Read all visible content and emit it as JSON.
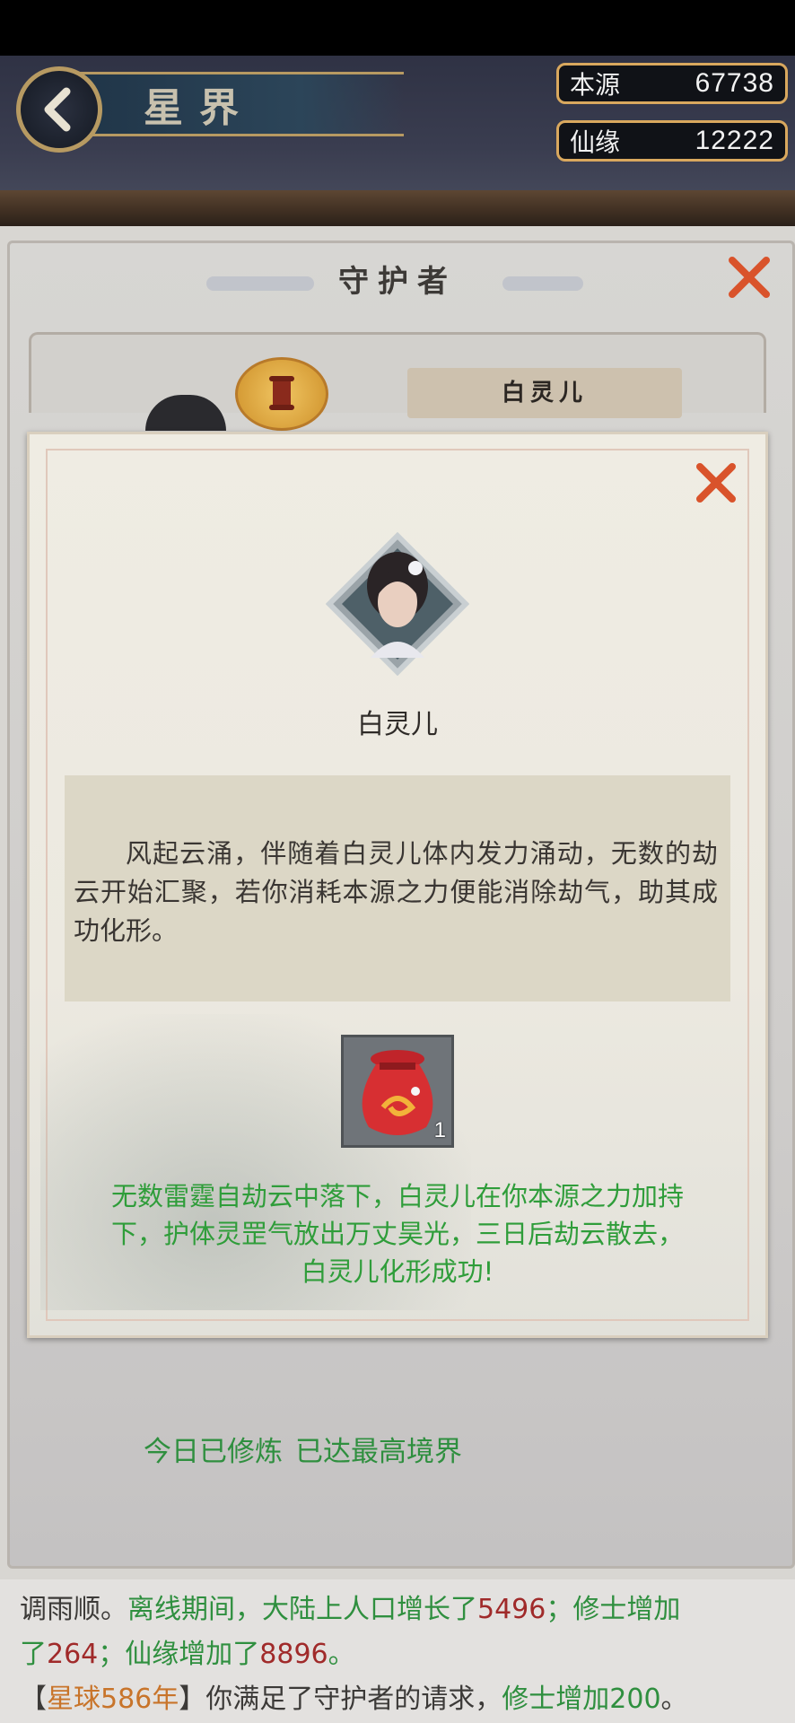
{
  "header": {
    "title": "星界",
    "resources": [
      {
        "label": "本源",
        "value": "67738"
      },
      {
        "label": "仙缘",
        "value": "12222"
      }
    ]
  },
  "guardian_panel": {
    "title": "守护者",
    "hero_name": "白灵儿",
    "status_today": "今日已修炼",
    "status_realm": "已达最高境界"
  },
  "modal": {
    "hero_name": "白灵儿",
    "description": "风起云涌，伴随着白灵儿体内发力涌动，无数的劫云开始汇聚，若你消耗本源之力便能消除劫气，助其成功化形。",
    "item": {
      "icon": "red-pouch-icon",
      "count": "1"
    },
    "result": "无数雷霆自劫云中落下，白灵儿在你本源之力加持下，护体灵罡气放出万丈昊光，三日后劫云散去，白灵儿化形成功!"
  },
  "log": {
    "line1_a": "调雨顺。",
    "line1_b": "离线期间，大陆上人口增长了",
    "line1_c": "5496",
    "line1_d": "；修士增加",
    "line2_a": "了",
    "line2_b": "264",
    "line2_c": "；仙缘增加了",
    "line2_d": "8896",
    "line2_e": "。",
    "line3_a": "【",
    "line3_b": "星球586年",
    "line3_c": "】你满足了守护者的请求，",
    "line3_d": "修士增加200",
    "line3_e": "。"
  },
  "colors": {
    "accent_gold": "#d9a85e",
    "success_green": "#2f9d3a",
    "close_red": "#d9532b"
  }
}
